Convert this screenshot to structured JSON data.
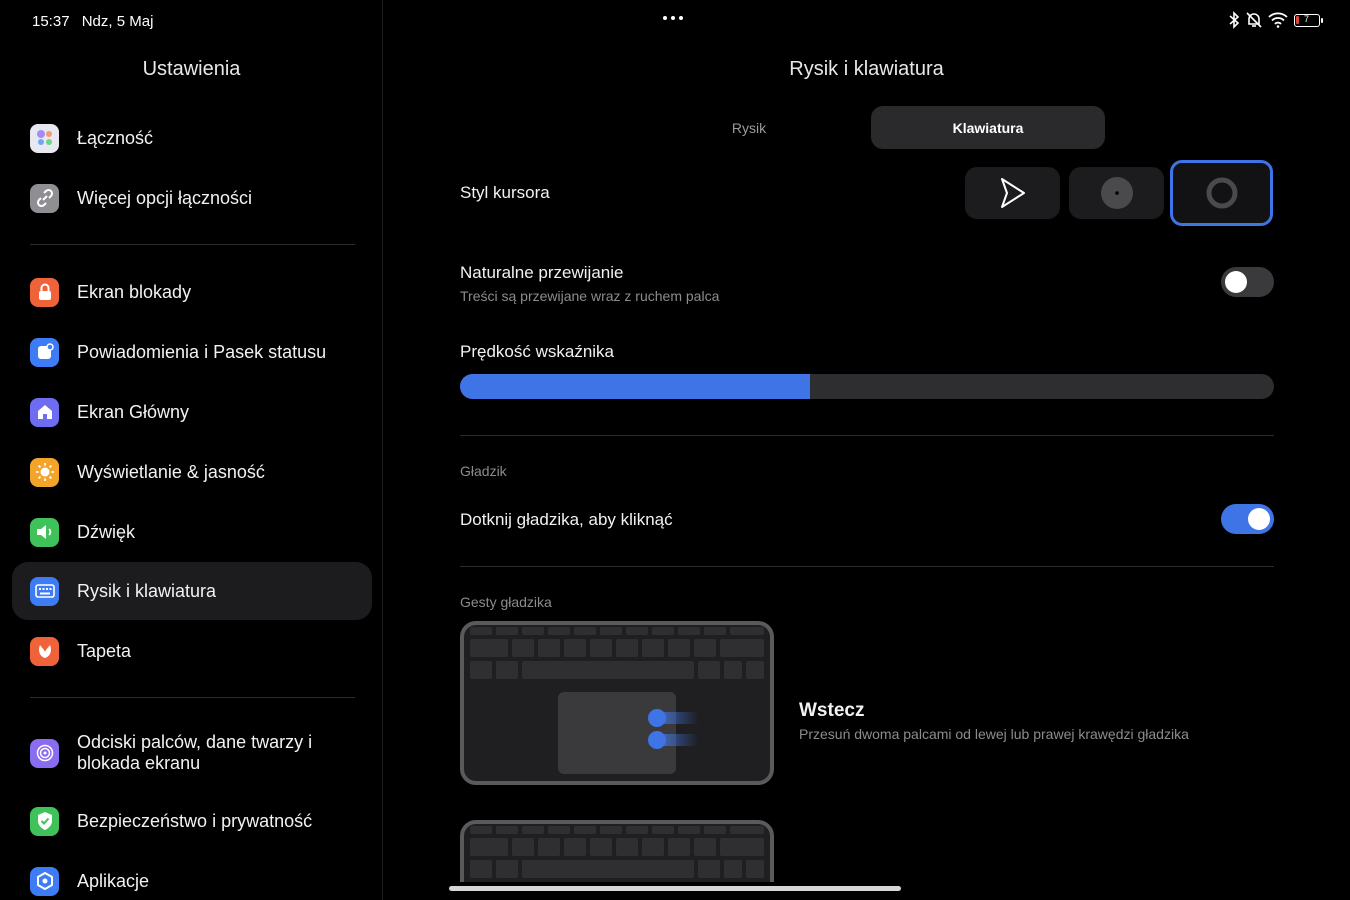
{
  "status": {
    "time": "15:37",
    "date": "Ndz, 5 Maj",
    "battery": "7",
    "icons": [
      "bluetooth-icon",
      "bell-off-icon",
      "wifi-icon",
      "battery-icon"
    ]
  },
  "sidebar": {
    "title": "Ustawienia",
    "items": [
      {
        "label": "Łączność",
        "icon": "connectivity-icon",
        "color": "#e8e8f0"
      },
      {
        "label": "Więcej opcji łączności",
        "icon": "link-icon",
        "color": "#8e8e93"
      },
      {
        "label": "Ekran blokady",
        "icon": "lock-icon",
        "color": "#f0623a"
      },
      {
        "label": "Powiadomienia i Pasek statusu",
        "icon": "notification-icon",
        "color": "#3d7cf5"
      },
      {
        "label": "Ekran Główny",
        "icon": "home-icon",
        "color": "#6e6cf0"
      },
      {
        "label": "Wyświetlanie & jasność",
        "icon": "sun-icon",
        "color": "#f3a52a"
      },
      {
        "label": "Dźwięk",
        "icon": "speaker-icon",
        "color": "#3fc25a"
      },
      {
        "label": "Rysik i klawiatura",
        "icon": "keyboard-icon",
        "color": "#3d7cf5"
      },
      {
        "label": "Tapeta",
        "icon": "wallpaper-icon",
        "color": "#f0623a"
      },
      {
        "label": "Odciski palców, dane twarzy i blokada ekranu",
        "icon": "fingerprint-icon",
        "color": "#8a6cf0"
      },
      {
        "label": "Bezpieczeństwo i prywatność",
        "icon": "shield-icon",
        "color": "#3fc25a"
      },
      {
        "label": "Aplikacje",
        "icon": "apps-icon",
        "color": "#3d7cf5"
      }
    ]
  },
  "main": {
    "title": "Rysik i klawiatura",
    "tabs": [
      {
        "label": "Rysik",
        "active": false
      },
      {
        "label": "Klawiatura",
        "active": true
      }
    ],
    "cursor_style": {
      "label": "Styl kursora",
      "options": [
        "arrow-cursor-icon",
        "dot-cursor-icon",
        "ring-cursor-icon"
      ],
      "selected": 2
    },
    "natural_scroll": {
      "label": "Naturalne przewijanie",
      "sub": "Treści są przewijane wraz z ruchem palca",
      "on": false
    },
    "pointer_speed": {
      "label": "Prędkość wskaźnika",
      "value": 0.43
    },
    "touchpad_section": "Gładzik",
    "tap_to_click": {
      "label": "Dotknij gładzika, aby kliknąć",
      "on": true
    },
    "gestures_section": "Gesty gładzika",
    "gesture": {
      "title": "Wstecz",
      "desc": "Przesuń dwoma palcami od lewej lub prawej krawędzi gładzika"
    },
    "colors": {
      "accent": "#3f74e6"
    }
  }
}
